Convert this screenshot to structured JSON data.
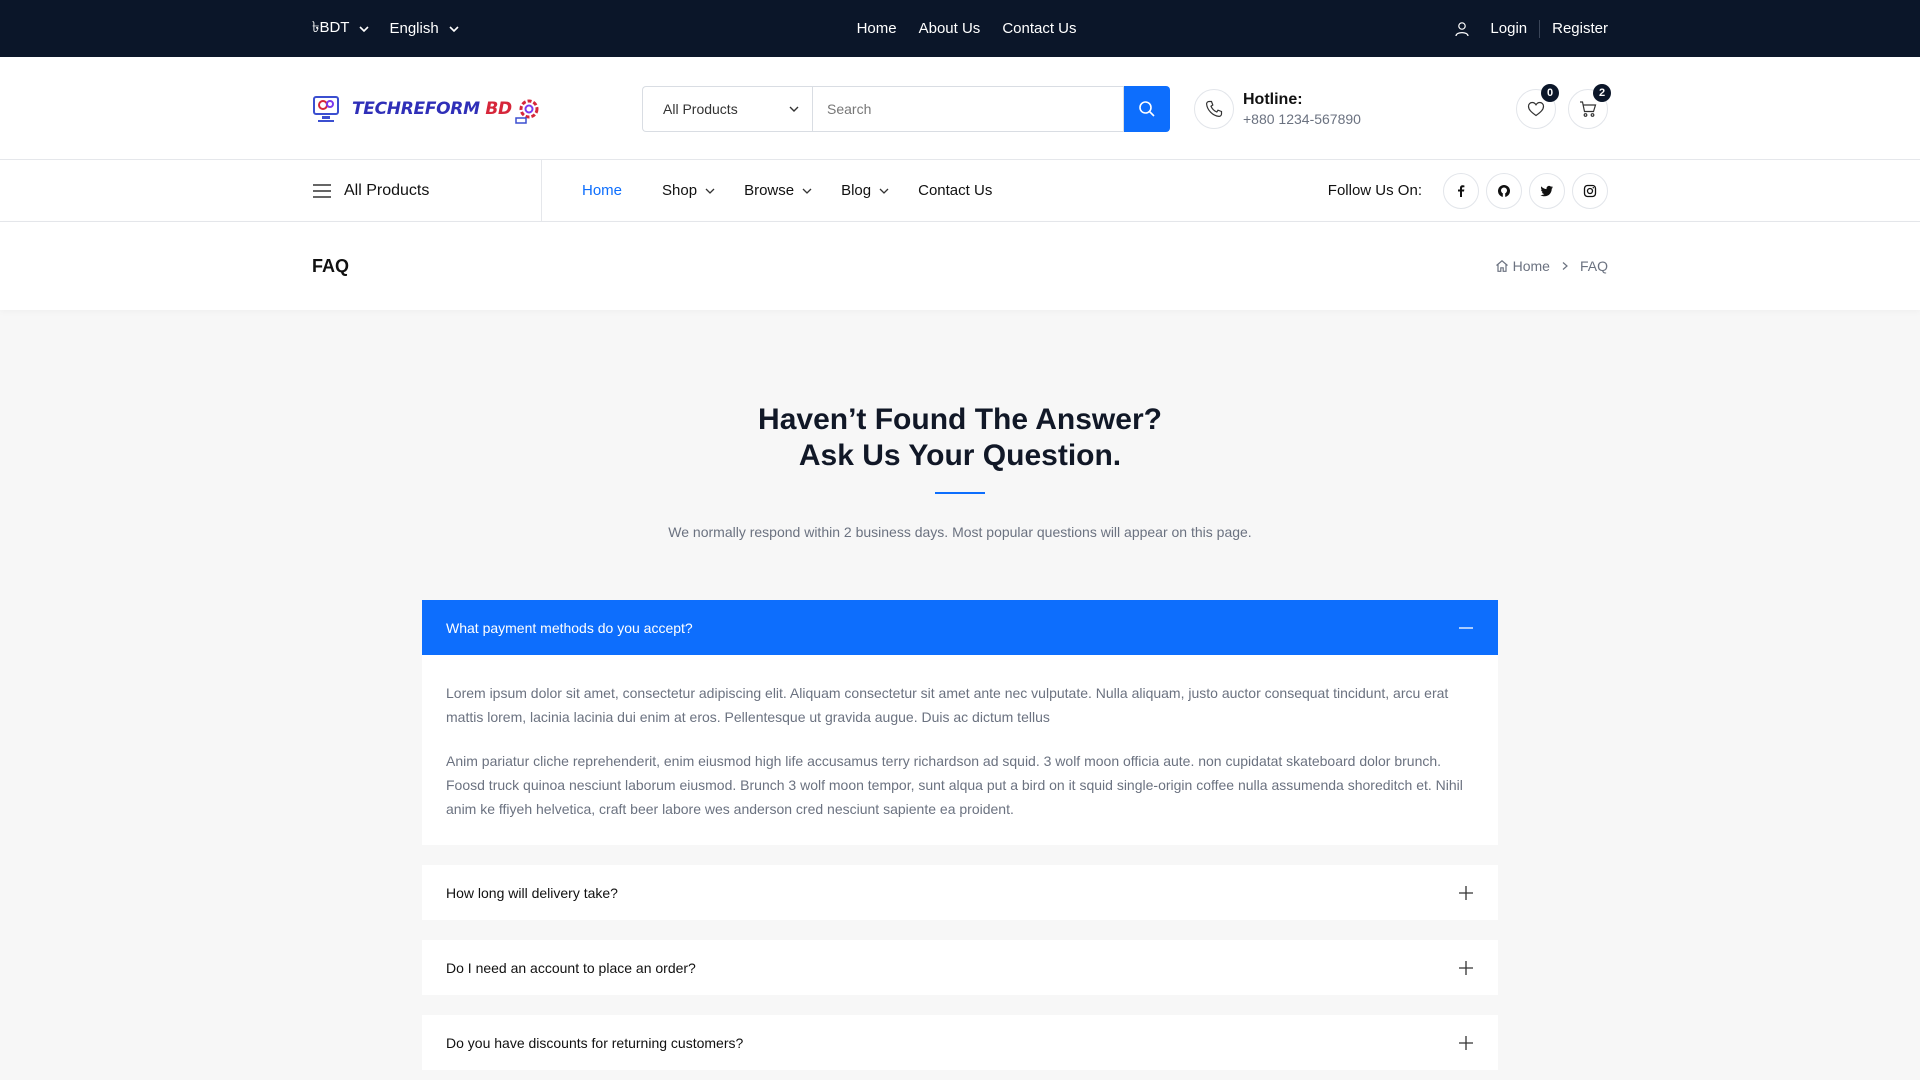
{
  "topbar": {
    "currency": "৳BDT",
    "language": "English",
    "links": [
      "Home",
      "About Us",
      "Contact Us"
    ],
    "login": "Login",
    "register": "Register"
  },
  "header": {
    "logo_part1": "TECHREFORM",
    "logo_part2": "BD",
    "category_selected": "All Products",
    "search_placeholder": "Search",
    "hotline_label": "Hotline:",
    "hotline_number": "+880 1234-567890",
    "wishlist_count": "0",
    "cart_count": "2"
  },
  "nav": {
    "all_products": "All Products",
    "home": "Home",
    "shop": "Shop",
    "browse": "Browse",
    "blog": "Blog",
    "contact": "Contact Us",
    "follow_label": "Follow Us On:"
  },
  "breadcrumb": {
    "page_title": "FAQ",
    "home": "Home",
    "current": "FAQ"
  },
  "faq": {
    "title_line1": "Haven’t Found The Answer?",
    "title_line2": "Ask Us Your Question.",
    "subtitle": "We normally respond within 2 business days. Most popular questions will appear on this page.",
    "items": [
      {
        "question": "What payment methods do you accept?",
        "answer_p1": "Lorem ipsum dolor sit amet, consectetur adipiscing elit. Aliquam consectetur sit amet ante nec vulputate. Nulla aliquam, justo auctor consequat tincidunt, arcu erat mattis lorem, lacinia lacinia dui enim at eros. Pellentesque ut gravida augue. Duis ac dictum tellus",
        "answer_p2": "Anim pariatur cliche reprehenderit, enim eiusmod high life accusamus terry richardson ad squid. 3 wolf moon officia aute. non cupidatat skateboard dolor brunch. Foosd truck quinoa nesciunt laborum eiusmod. Brunch 3 wolf moon tempor, sunt alqua put a bird on it squid single-origin coffee nulla assumenda shoreditch et. Nihil anim ke ffiyeh helvetica, craft beer labore wes anderson cred nesciunt sapiente ea proident."
      },
      {
        "question": "How long will delivery take?"
      },
      {
        "question": "Do I need an account to place an order?"
      },
      {
        "question": "Do you have discounts for returning customers?"
      }
    ]
  },
  "colors": {
    "primary": "#0d6efd",
    "topbar_bg": "#0b1629",
    "page_bg": "#f7f7f7"
  }
}
